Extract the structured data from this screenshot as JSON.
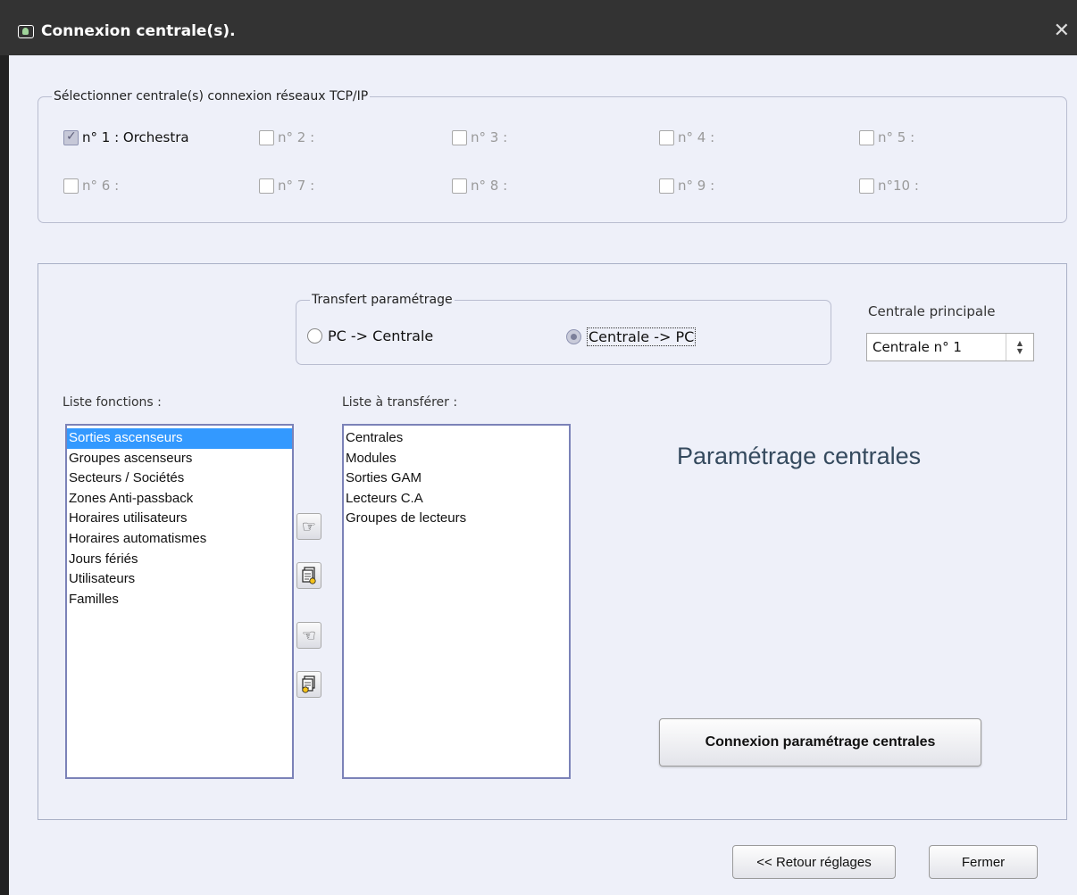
{
  "window": {
    "title": "Connexion centrale(s).",
    "close_glyph": "✕"
  },
  "centrales_group": {
    "legend": "Sélectionner centrale(s) connexion réseaux TCP/IP",
    "items": [
      {
        "label": "n° 1 : Orchestra",
        "checked": true
      },
      {
        "label": "n° 2 :",
        "checked": false
      },
      {
        "label": "n° 3 :",
        "checked": false
      },
      {
        "label": "n° 4 :",
        "checked": false
      },
      {
        "label": "n° 5 :",
        "checked": false
      },
      {
        "label": "n° 6 :",
        "checked": false
      },
      {
        "label": "n° 7 :",
        "checked": false
      },
      {
        "label": "n° 8 :",
        "checked": false
      },
      {
        "label": "n° 9 :",
        "checked": false
      },
      {
        "label": "n°10 :",
        "checked": false
      }
    ]
  },
  "transfer": {
    "legend": "Transfert paramétrage",
    "option_pc_to_centrale": "PC -> Centrale",
    "option_centrale_to_pc": "Centrale -> PC",
    "selected": "Centrale -> PC"
  },
  "centrale_principale": {
    "label": "Centrale principale",
    "value": "Centrale n° 1"
  },
  "liste_fonctions": {
    "label": "Liste fonctions :",
    "items": [
      "Sorties ascenseurs",
      "Groupes ascenseurs",
      "Secteurs / Sociétés",
      "Zones Anti-passback",
      "Horaires utilisateurs",
      "Horaires automatismes",
      "Jours fériés",
      "Utilisateurs",
      "Familles"
    ],
    "selected_index": 0
  },
  "liste_transferer": {
    "label": "Liste à transférer :",
    "items": [
      "Centrales",
      "Modules",
      "Sorties GAM",
      "Lecteurs C.A",
      "Groupes de lecteurs"
    ]
  },
  "transfer_buttons": {
    "add_one_icon": "hand-pointing-right-icon",
    "add_all_icon": "document-stack-add-icon",
    "remove_one_icon": "hand-pointing-left-icon",
    "remove_all_icon": "document-stack-remove-icon"
  },
  "section_title": "Paramétrage centrales",
  "buttons": {
    "connect": "Connexion paramétrage centrales",
    "back": "<< Retour réglages",
    "close": "Fermer"
  },
  "colors": {
    "titlebar": "#333333",
    "selection": "#3399ff",
    "window_bg": "#eef0f9"
  }
}
